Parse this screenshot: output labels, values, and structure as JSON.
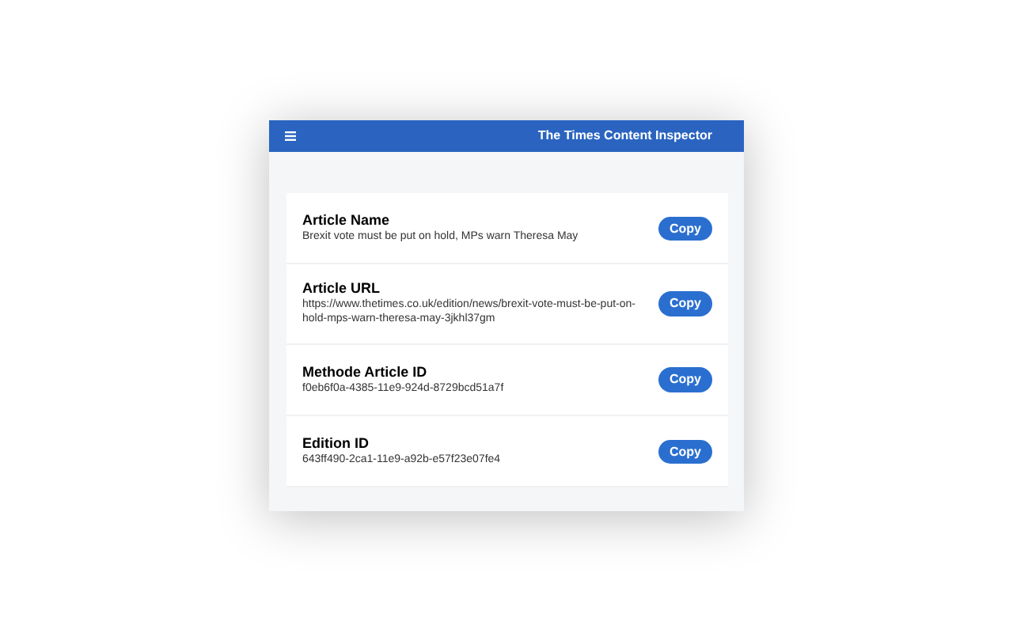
{
  "header": {
    "title": "The Times Content Inspector"
  },
  "fields": [
    {
      "label": "Article Name",
      "value": "Brexit vote must be put on hold, MPs warn Theresa May",
      "button": "Copy"
    },
    {
      "label": "Article URL",
      "value": "https://www.thetimes.co.uk/edition/news/brexit-vote-must-be-put-on-hold-mps-warn-theresa-may-3jkhl37gm",
      "button": "Copy"
    },
    {
      "label": "Methode Article ID",
      "value": "f0eb6f0a-4385-11e9-924d-8729bcd51a7f",
      "button": "Copy"
    },
    {
      "label": "Edition ID",
      "value": "643ff490-2ca1-11e9-a92b-e57f23e07fe4",
      "button": "Copy"
    }
  ]
}
